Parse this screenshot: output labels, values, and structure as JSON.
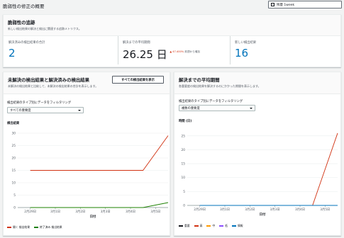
{
  "header": {
    "title": "脆弱性の修正の概要",
    "range_label": "残量 1week"
  },
  "tracking": {
    "title": "脆弱性の追跡",
    "description": "新しい検出結果の解決と検出に関連する追跡メトリクス。",
    "kpis": [
      {
        "label": "解決済みの検出結果の合計",
        "value": "2"
      },
      {
        "label": "解決までの平均期間",
        "value": "26.25 日",
        "change": "▲ 47.400%",
        "change_note": "前週から増加"
      },
      {
        "label": "新しい検出結果",
        "value": "16"
      }
    ]
  },
  "left_panel": {
    "title": "未解決の検出結果と解決済みの検出結果",
    "description": "未解決の検出結果と比較して、未解決の検出結果の合計を表示します。",
    "button": "すべての検出結果を表示",
    "filter_label": "検出結果のタイプ別にデータをフィルタリング",
    "filter_value": "すべての重要度",
    "chart_data": {
      "type": "line",
      "ylabel": "検出結果",
      "xlabel": "日付",
      "x": [
        "2月29日",
        "3月1日",
        "3月2日",
        "3月3日",
        "3月4日",
        "3月5日"
      ],
      "yticks": [
        0,
        5,
        10,
        15,
        20,
        25,
        30
      ],
      "ylim": [
        0,
        30
      ],
      "series": [
        {
          "name": "開く 検出結果",
          "color": "#d13212",
          "points": [
            [
              0,
              15
            ],
            [
              4.5,
              15
            ],
            [
              5.5,
              29
            ]
          ]
        },
        {
          "name": "終了済み 検出結果",
          "color": "#1d8102",
          "points": [
            [
              0,
              0
            ],
            [
              4.5,
              0
            ],
            [
              5.5,
              2
            ]
          ]
        }
      ]
    }
  },
  "right_panel": {
    "title": "解決までの平均期間",
    "description": "各重要度の検出結果を解決するのにかかった期間を表示します。",
    "filter_label": "検出結果のタイプ別にデータをフィルタリング",
    "filter_value": "複数の重要度",
    "chart_data": {
      "type": "line",
      "ylabel": "時間 (日)",
      "xlabel": "日付",
      "x": [
        "2月29日",
        "3月1日",
        "3月2日",
        "3月3日",
        "3月4日",
        "3月5日"
      ],
      "yticks": [
        0,
        5,
        10,
        15,
        20,
        25
      ],
      "ylim": [
        0,
        27
      ],
      "series": [
        {
          "name": "重要",
          "color": "#16191f",
          "points": [
            [
              0,
              0
            ],
            [
              4.5,
              0
            ],
            [
              5.5,
              0
            ]
          ]
        },
        {
          "name": "高",
          "color": "#d13212",
          "points": [
            [
              0,
              0
            ],
            [
              4.5,
              0
            ],
            [
              5.5,
              26
            ]
          ]
        },
        {
          "name": "中",
          "color": "#ff9900",
          "points": [
            [
              0,
              0
            ],
            [
              5.5,
              0
            ]
          ]
        },
        {
          "name": "低",
          "color": "#8c4fff",
          "points": [
            [
              0,
              0
            ],
            [
              5.5,
              0
            ]
          ]
        },
        {
          "name": "情報",
          "color": "#0073bb",
          "points": [
            [
              0,
              0
            ],
            [
              5.5,
              0
            ]
          ]
        }
      ]
    }
  }
}
